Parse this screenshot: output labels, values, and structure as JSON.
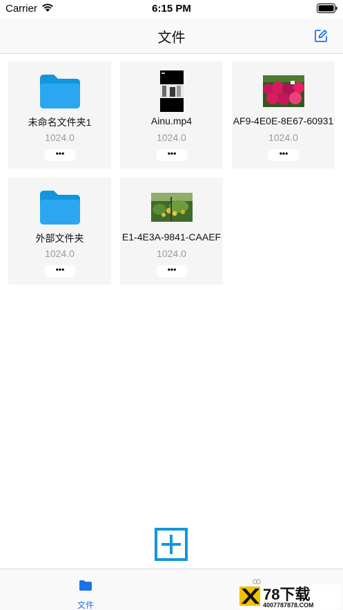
{
  "status_bar": {
    "carrier": "Carrier",
    "time": "6:15 PM"
  },
  "nav": {
    "title": "文件",
    "edit_icon": "edit-square-icon"
  },
  "files": [
    {
      "type": "folder",
      "name": "未命名文件夹1",
      "size": "1024.0",
      "more": "•••"
    },
    {
      "type": "video",
      "name": "Ainu.mp4",
      "size": "1024.0",
      "more": "•••"
    },
    {
      "type": "image",
      "name": "AF9-4E0E-8E67-60931",
      "size": "1024.0",
      "more": "•••"
    },
    {
      "type": "folder",
      "name": "外部文件夹",
      "size": "1024.0",
      "more": "•••"
    },
    {
      "type": "image",
      "name": "E1-4E3A-9841-CAAEF",
      "size": "1024.0",
      "more": "•••"
    }
  ],
  "add_button": {
    "icon": "plus-square-icon"
  },
  "tab_bar": {
    "tabs": [
      {
        "label": "文件",
        "icon": "folder-icon",
        "active": true
      },
      {
        "label": "",
        "icon": "people-icon",
        "active": false
      }
    ]
  },
  "watermark": {
    "logo_text": "78下载",
    "number": "4007787878.COM"
  },
  "colors": {
    "accent": "#1a73e8",
    "folder": "#1296db",
    "tile_bg": "#f5f5f5"
  }
}
